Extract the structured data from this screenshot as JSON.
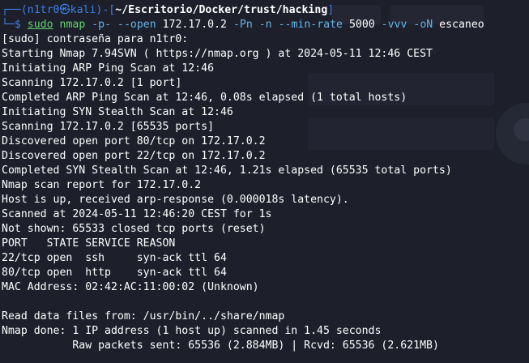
{
  "prompt": {
    "frame_top": "┌──(",
    "user": "n1tr0",
    "at_symbol": "㉿",
    "host": "kali",
    "frame_mid": ")-[",
    "path": "~/Escritorio/Docker/trust/hacking",
    "frame_close": "]",
    "frame_bottom": "└─",
    "dollar": "$ "
  },
  "command": {
    "sudo": "sudo",
    "program": "nmap",
    "args": [
      {
        "text": "-p-",
        "kind": "opt"
      },
      {
        "text": "--open",
        "kind": "opt"
      },
      {
        "text": "172.17.0.2",
        "kind": "arg"
      },
      {
        "text": "-Pn",
        "kind": "opt"
      },
      {
        "text": "-n",
        "kind": "opt"
      },
      {
        "text": "--min-rate",
        "kind": "opt"
      },
      {
        "text": "5000",
        "kind": "arg"
      },
      {
        "text": "-vvv",
        "kind": "opt"
      },
      {
        "text": "-oN",
        "kind": "opt"
      },
      {
        "text": "escaneo",
        "kind": "arg"
      }
    ]
  },
  "output": [
    "[sudo] contraseña para n1tr0:",
    "Starting Nmap 7.94SVN ( https://nmap.org ) at 2024-05-11 12:46 CEST",
    "Initiating ARP Ping Scan at 12:46",
    "Scanning 172.17.0.2 [1 port]",
    "Completed ARP Ping Scan at 12:46, 0.08s elapsed (1 total hosts)",
    "Initiating SYN Stealth Scan at 12:46",
    "Scanning 172.17.0.2 [65535 ports]",
    "Discovered open port 80/tcp on 172.17.0.2",
    "Discovered open port 22/tcp on 172.17.0.2",
    "Completed SYN Stealth Scan at 12:46, 1.21s elapsed (65535 total ports)",
    "Nmap scan report for 172.17.0.2",
    "Host is up, received arp-response (0.000018s latency).",
    "Scanned at 2024-05-11 12:46:20 CEST for 1s",
    "Not shown: 65533 closed tcp ports (reset)",
    "PORT   STATE SERVICE REASON",
    "22/tcp open  ssh     syn-ack ttl 64",
    "80/tcp open  http    syn-ack ttl 64",
    "MAC Address: 02:42:AC:11:00:02 (Unknown)",
    "",
    "Read data files from: /usr/bin/../share/nmap",
    "Nmap done: 1 IP address (1 host up) scanned in 1.45 seconds",
    "           Raw packets sent: 65536 (2.884MB) | Rcvd: 65536 (2.621MB)"
  ],
  "colors": {
    "background": "#1d202b",
    "prompt_blue": "#3d7fe6",
    "command_green": "#61d46e",
    "option_blue": "#66b3e8",
    "text": "#ffffff"
  }
}
